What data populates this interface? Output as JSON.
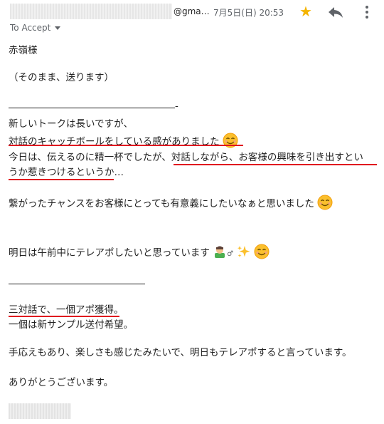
{
  "header": {
    "sender_domain": "@gma…",
    "date": "7月5日(日) 20:53",
    "recipient_label": "To Accept"
  },
  "icons": {
    "star": "star-icon",
    "reply": "reply-icon",
    "more": "more-vert-icon",
    "smile": "smiling-face-emoji",
    "person": "person-bowing-emoji",
    "sparkles": "sparkles-emoji"
  },
  "colors": {
    "star": "#f4b400",
    "underline": "#e0161f"
  },
  "message": {
    "greeting": "赤嶺様",
    "note": "（そのまま、送ります）",
    "line_dash": "-",
    "p1_line1": "新しいトークは長いですが、",
    "p1_line2": "対話のキャッチボールをしている感がありました",
    "p1_line3": "今日は、伝えるのに精一杯でしたが、対話しながら、お客様の興味を引き出すとい",
    "p1_line4": "うか惹きつけるというか…",
    "p2": "繋がったチャンスをお客様にとっても有意義にしたいなぁと思いました",
    "p3": "明日は午前中にテレアポしたいと思っています",
    "p3_symbol": "♂",
    "result_line1": "三対話で、一個アポ獲得。",
    "result_line2": "一個は新サンプル送付希望。",
    "p4": "手応えもあり、楽しさも感じたみたいで、明日もテレアポすると言っています。",
    "closing": "ありがとうございます。"
  }
}
